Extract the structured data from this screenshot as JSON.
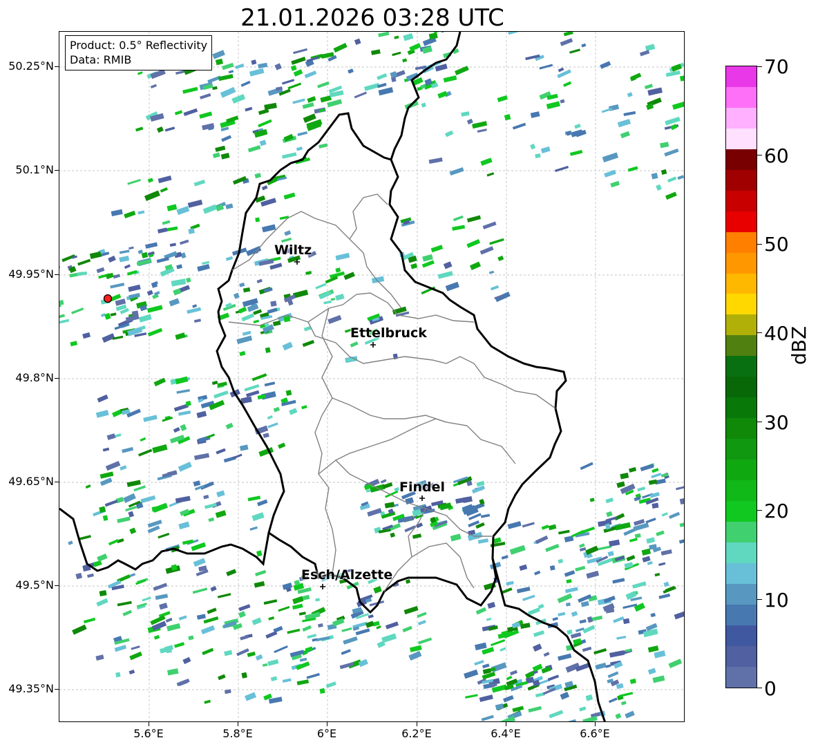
{
  "title": "21.01.2026 03:28 UTC",
  "infobox": {
    "product": "Product: 0.5° Reflectivity",
    "data": "Data: RMIB"
  },
  "axes": {
    "lat_labels": [
      "50.25°N",
      "50.1°N",
      "49.95°N",
      "49.8°N",
      "49.65°N",
      "49.5°N",
      "49.35°N"
    ],
    "lon_labels": [
      "5.6°E",
      "5.8°E",
      "6°E",
      "6.2°E",
      "6.4°E",
      "6.6°E"
    ]
  },
  "cities": [
    {
      "name": "Wiltz"
    },
    {
      "name": "Ettelbruck"
    },
    {
      "name": "Findel"
    },
    {
      "name": "Esch/Alzette"
    }
  ],
  "colorbar": {
    "unit": "dBZ",
    "tick_labels": [
      "70",
      "60",
      "50",
      "40",
      "30",
      "20",
      "10",
      "0"
    ],
    "colors": [
      "#6070a8",
      "#5060a0",
      "#4058a0",
      "#4878b0",
      "#5898c0",
      "#68c0d8",
      "#60d8c0",
      "#40d070",
      "#10c820",
      "#10b818",
      "#10a810",
      "#109810",
      "#108808",
      "#087808",
      "#086808",
      "#087010",
      "#508010",
      "#b0b008",
      "#ffd800",
      "#ffb800",
      "#ff9800",
      "#ff8000",
      "#e80000",
      "#c80000",
      "#a00000",
      "#780000",
      "#ffe0ff",
      "#ffb0ff",
      "#ff70f8",
      "#e838e8"
    ]
  },
  "radar_site": {
    "label": "radar-site"
  },
  "chart_data": {
    "type": "map",
    "title": "21.01.2026 03:28 UTC",
    "product": "0.5° Reflectivity",
    "source": "RMIB",
    "lon_range": [
      5.4,
      6.8
    ],
    "lat_range": [
      49.3,
      50.3
    ],
    "colorbar_range_dBZ": [
      0,
      70
    ]
  }
}
